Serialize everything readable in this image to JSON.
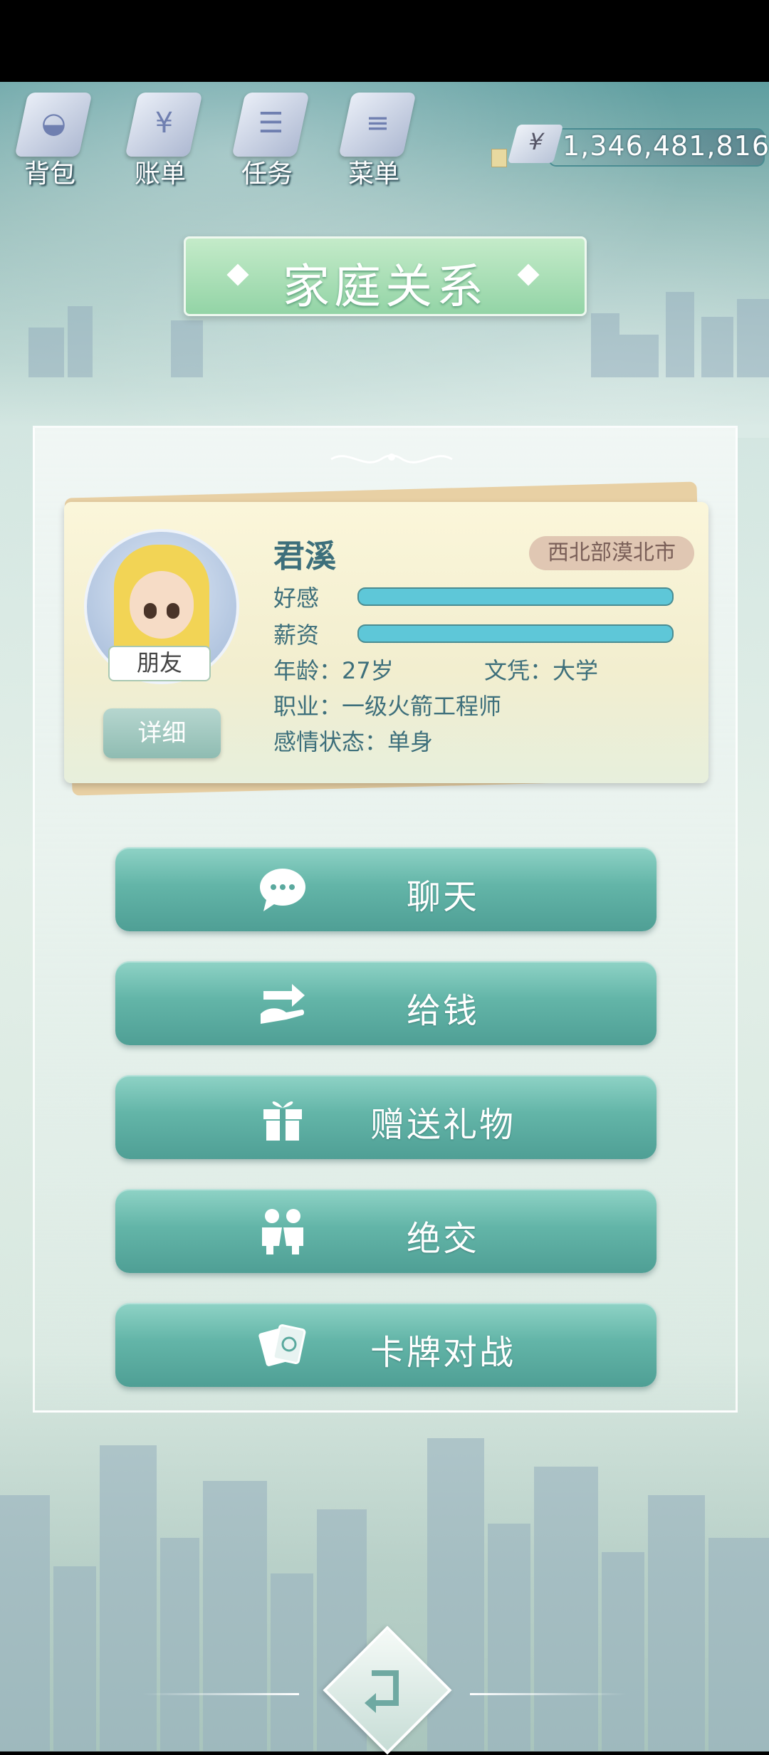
{
  "toolbar": {
    "items": [
      {
        "label": "背包",
        "icon": "bag-icon"
      },
      {
        "label": "账单",
        "icon": "bill-icon"
      },
      {
        "label": "任务",
        "icon": "task-icon"
      },
      {
        "label": "菜单",
        "icon": "menu-icon"
      }
    ],
    "money": {
      "symbol": "¥",
      "value": "1,346,481,816"
    }
  },
  "title": "家庭关系",
  "profile": {
    "name": "君溪",
    "location": "西北部漠北市",
    "relation": "朋友",
    "detail_button": "详细",
    "favor_label": "好感",
    "favor_level": 1.0,
    "salary_label": "薪资",
    "salary_level": 1.0,
    "age": "年龄：27岁",
    "education": "文凭：大学",
    "job": "职业：一级火箭工程师",
    "relationship_status": "感情状态：单身"
  },
  "actions": [
    {
      "label": "聊天",
      "icon": "chat-icon"
    },
    {
      "label": "给钱",
      "icon": "give-money-icon"
    },
    {
      "label": "赠送礼物",
      "icon": "gift-icon"
    },
    {
      "label": "绝交",
      "icon": "break-up-icon"
    },
    {
      "label": "卡牌对战",
      "icon": "card-battle-icon"
    }
  ],
  "colors": {
    "button": "#63b5a8",
    "banner": "#93d4a6",
    "bar": "#5ec7d8",
    "text": "#3d6f7b"
  }
}
